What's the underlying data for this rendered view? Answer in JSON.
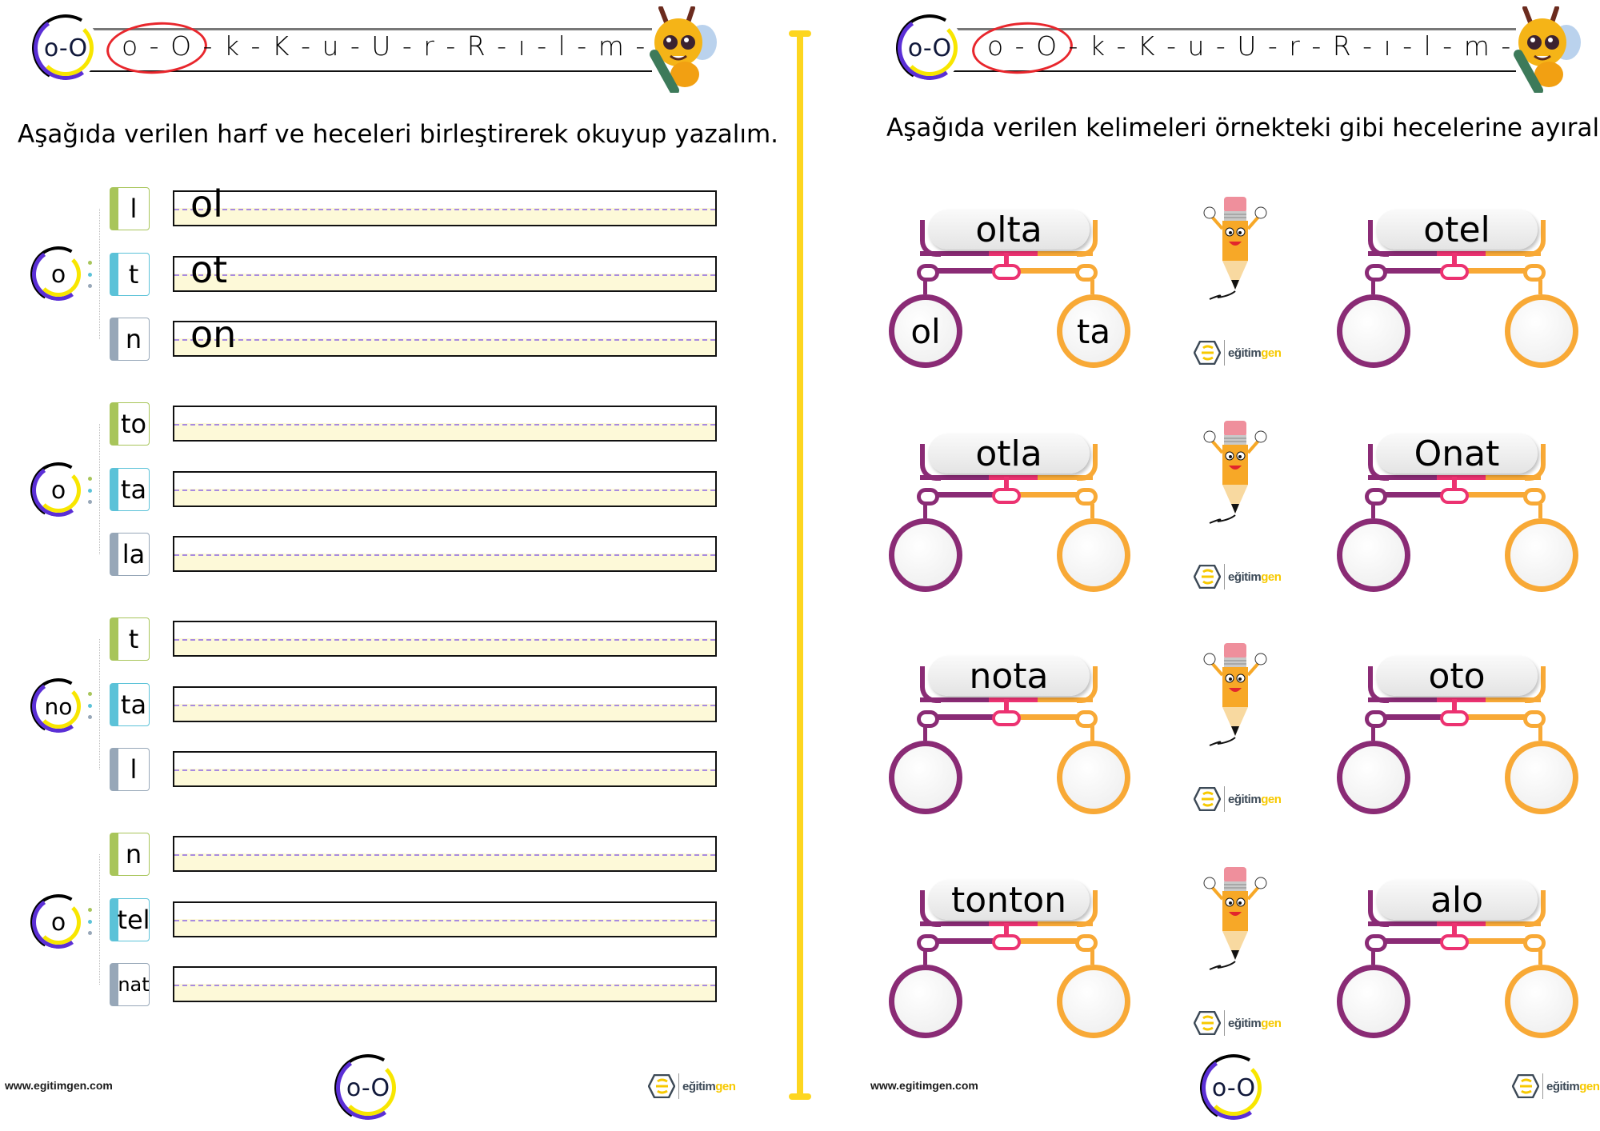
{
  "left_page": {
    "header": {
      "logo_label": "o-O",
      "letter_sequence": "o - O - k - K - u - U - r - R - ı - l - m - M",
      "highlighted": "o - O"
    },
    "instruction": "Aşağıda verilen harf ve heceleri birleştirerek okuyup yazalım.",
    "groups": [
      {
        "root": "o",
        "items": [
          {
            "syllable": "l",
            "answer": "ol"
          },
          {
            "syllable": "t",
            "answer": "ot"
          },
          {
            "syllable": "n",
            "answer": "on"
          }
        ]
      },
      {
        "root": "o",
        "items": [
          {
            "syllable": "to",
            "answer": ""
          },
          {
            "syllable": "ta",
            "answer": ""
          },
          {
            "syllable": "la",
            "answer": ""
          }
        ]
      },
      {
        "root": "no",
        "items": [
          {
            "syllable": "t",
            "answer": ""
          },
          {
            "syllable": "ta",
            "answer": ""
          },
          {
            "syllable": "l",
            "answer": ""
          }
        ]
      },
      {
        "root": "o",
        "items": [
          {
            "syllable": "n",
            "answer": ""
          },
          {
            "syllable": "tel",
            "answer": ""
          },
          {
            "syllable": "nat",
            "answer": ""
          }
        ]
      }
    ],
    "footer": {
      "url": "www.egitimgen.com",
      "logo_label": "o-O",
      "brand": "eğitim",
      "brand_accent": "gen"
    }
  },
  "right_page": {
    "header": {
      "logo_label": "o-O",
      "letter_sequence": "o - O - k - K - u - U - r - R - ı - l - m - M",
      "highlighted": "o - O"
    },
    "instruction": "Aşağıda verilen kelimeleri örnekteki gibi hecelerine ayıralım.",
    "cards_left": [
      {
        "word": "olta",
        "syllable1": "ol",
        "syllable2": "ta"
      },
      {
        "word": "otla",
        "syllable1": "",
        "syllable2": ""
      },
      {
        "word": "nota",
        "syllable1": "",
        "syllable2": ""
      },
      {
        "word": "tonton",
        "syllable1": "",
        "syllable2": ""
      }
    ],
    "cards_right": [
      {
        "word": "otel",
        "syllable1": "",
        "syllable2": ""
      },
      {
        "word": "Onat",
        "syllable1": "",
        "syllable2": ""
      },
      {
        "word": "oto",
        "syllable1": "",
        "syllable2": ""
      },
      {
        "word": "alo",
        "syllable1": "",
        "syllable2": ""
      }
    ],
    "footer": {
      "url": "www.egitimgen.com",
      "logo_label": "o-O",
      "brand": "eğitim",
      "brand_accent": "gen"
    }
  },
  "icons": {
    "mascot": "bee-mascot-icon",
    "pencil": "pencil-mascot-icon",
    "brand": "egitimgen-hex-logo-icon"
  },
  "colors": {
    "divider": "#fdd61f",
    "purple": "#8a2b75",
    "pink": "#ec3271",
    "orange": "#f8a936",
    "green_tab": "#a8c55a",
    "blue_tab": "#5bc2d8",
    "gray_tab": "#97a7b8",
    "highlight_ellipse": "#e8262c"
  }
}
